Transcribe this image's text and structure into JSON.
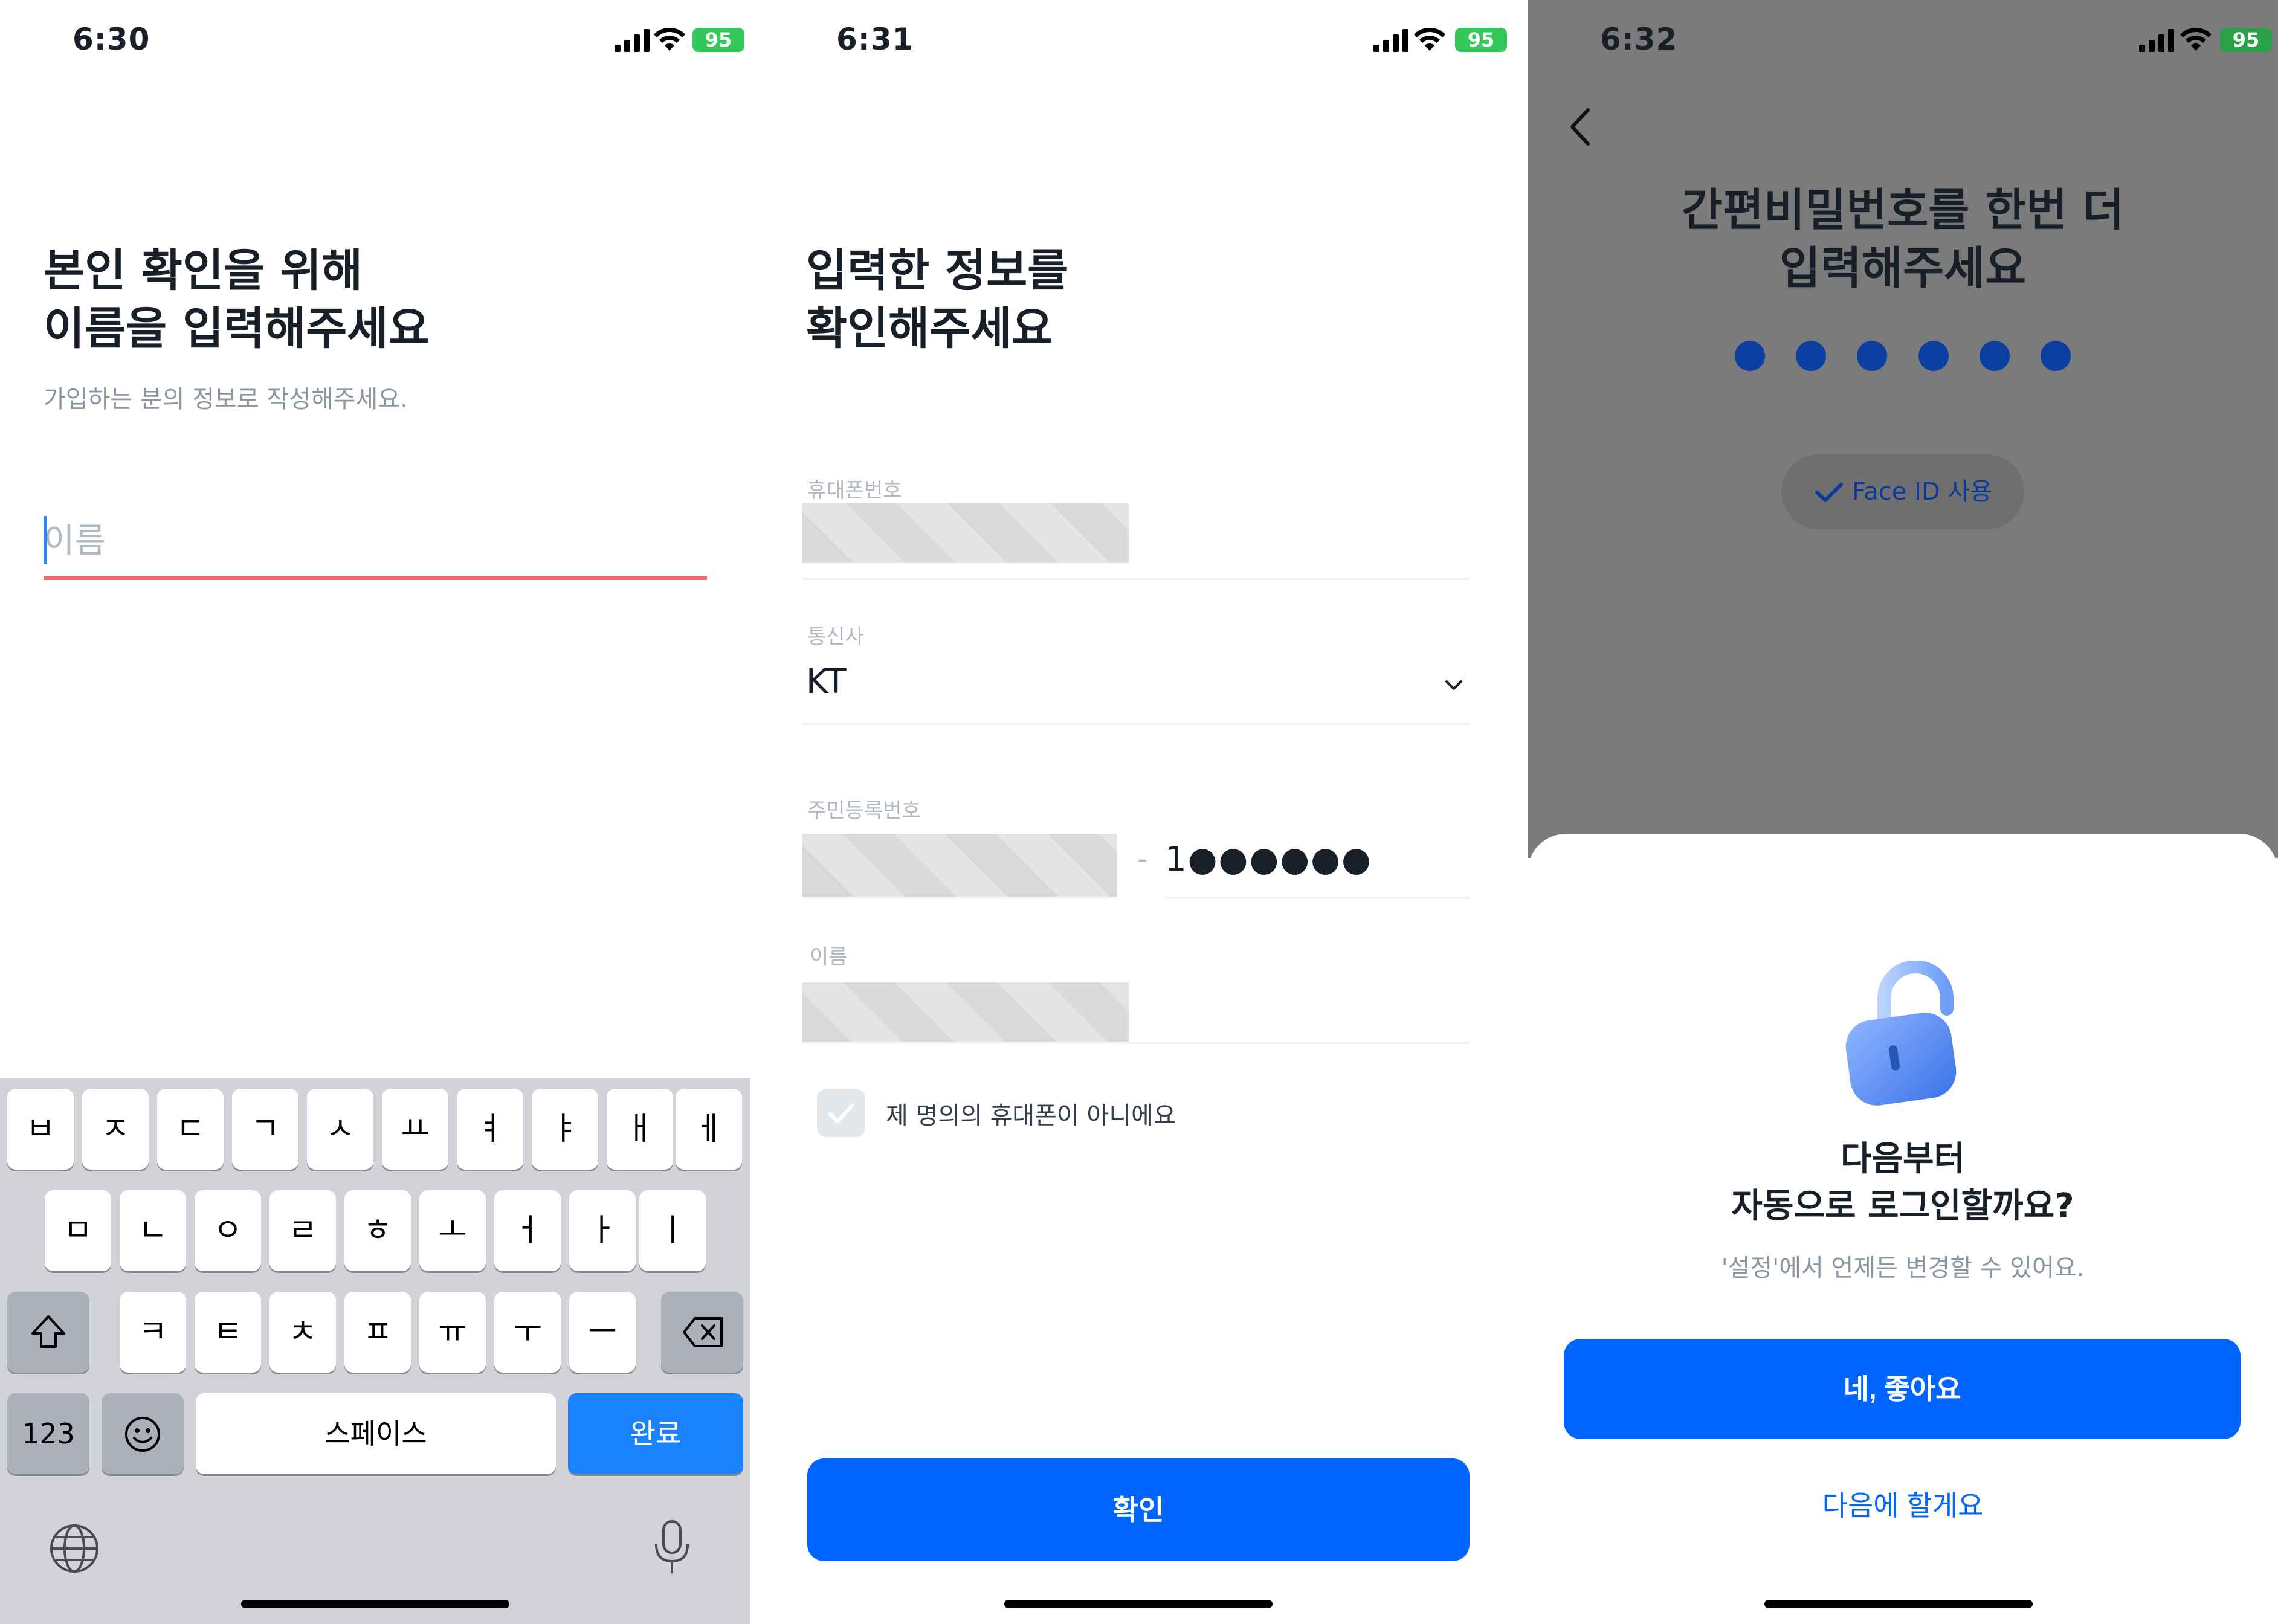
{
  "status_bars": [
    {
      "time": "6:30",
      "battery": "95"
    },
    {
      "time": "6:31",
      "battery": "95"
    },
    {
      "time": "6:32",
      "battery": "95"
    }
  ],
  "screen1": {
    "heading": "본인 확인을 위해\n이름을 입력해주세요",
    "subtitle": "가입하는 분의 정보로 작성해주세요.",
    "name_placeholder": "이름",
    "keyboard": {
      "row1": [
        "ㅂ",
        "ㅈ",
        "ㄷ",
        "ㄱ",
        "ㅅ",
        "ㅛ",
        "ㅕ",
        "ㅑ",
        "ㅐ",
        "ㅔ"
      ],
      "row2": [
        "ㅁ",
        "ㄴ",
        "ㅇ",
        "ㄹ",
        "ㅎ",
        "ㅗ",
        "ㅓ",
        "ㅏ",
        "ㅣ"
      ],
      "row3": [
        "ㅋ",
        "ㅌ",
        "ㅊ",
        "ㅍ",
        "ㅠ",
        "ㅜ",
        "ㅡ"
      ],
      "numbers_key": "123",
      "space_key": "스페이스",
      "done_key": "완료"
    }
  },
  "screen2": {
    "heading": "입력한 정보를\n확인해주세요",
    "phone_label": "휴대폰번호",
    "carrier_label": "통신사",
    "carrier_value": "KT",
    "rrn_label": "주민등록번호",
    "rrn_dash": "-",
    "rrn_back": "1●●●●●●",
    "name_label": "이름",
    "not_my_phone_label": "제 명의의 휴대폰이 아니에요",
    "confirm_button": "확인"
  },
  "screen3": {
    "pin_title": "간편비밀번호를 한번 더\n입력해주세요",
    "face_id_label": "Face ID 사용",
    "sheet_title": "다음부터\n자동으로 로그인할까요?",
    "sheet_subtitle": "'설정'에서 언제든 변경할 수 있어요.",
    "yes_button": "네, 좋아요",
    "later_button": "다음에 할게요",
    "pin_entered": 6
  },
  "colors": {
    "primary": "#0064ff",
    "error_underline": "#f06464",
    "battery": "#34c759"
  }
}
